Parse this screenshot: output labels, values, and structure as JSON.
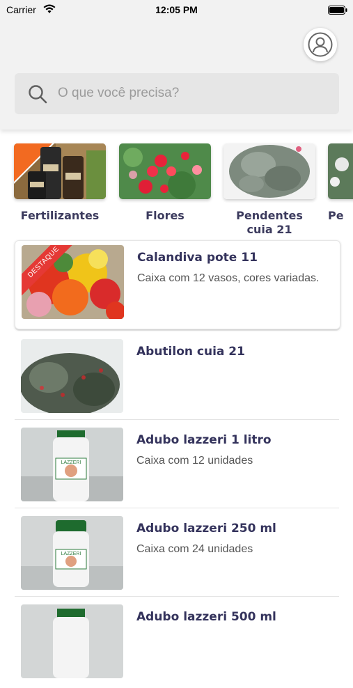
{
  "status_bar": {
    "carrier": "Carrier",
    "time": "12:05 PM"
  },
  "search": {
    "placeholder": "O que você precisa?"
  },
  "categories": [
    {
      "label": "Fertilizantes"
    },
    {
      "label": "Flores"
    },
    {
      "label": "Pendentes cuia 21"
    },
    {
      "label": "Pe"
    }
  ],
  "products": [
    {
      "title": "Calandiva pote 11",
      "description": "Caixa com 12 vasos, cores variadas.",
      "badge": "DESTAQUE"
    },
    {
      "title": "Abutilon cuia 21",
      "description": ""
    },
    {
      "title": "Adubo lazzeri 1 litro",
      "description": "Caixa com 12 unidades"
    },
    {
      "title": "Adubo lazzeri 250 ml",
      "description": "Caixa com 24 unidades"
    },
    {
      "title": "Adubo lazzeri 500 ml",
      "description": ""
    }
  ],
  "colors": {
    "accent": "#34335c",
    "badge": "#e53935"
  }
}
